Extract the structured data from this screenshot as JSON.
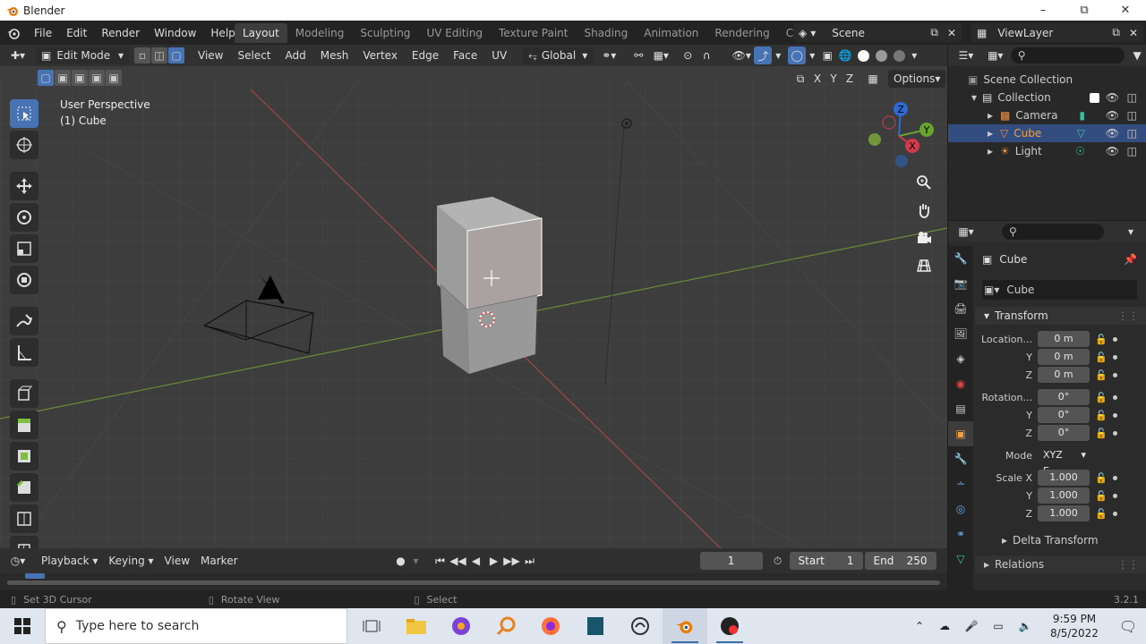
{
  "window": {
    "title": "Blender"
  },
  "menu": [
    "File",
    "Edit",
    "Render",
    "Window",
    "Help"
  ],
  "workspaces": [
    "Layout",
    "Modeling",
    "Sculpting",
    "UV Editing",
    "Texture Paint",
    "Shading",
    "Animation",
    "Rendering",
    "Compo"
  ],
  "active_workspace": "Layout",
  "scene": {
    "name": "Scene"
  },
  "view_layer": {
    "name": "ViewLayer"
  },
  "viewport_header": {
    "mode": "Edit Mode",
    "menus": [
      "View",
      "Select",
      "Add",
      "Mesh",
      "Vertex",
      "Edge",
      "Face",
      "UV"
    ],
    "orientation": "Global",
    "options_label": "Options",
    "axes": [
      "X",
      "Y",
      "Z"
    ]
  },
  "viewport": {
    "perspective_label": "User Perspective",
    "object_label": "(1) Cube"
  },
  "navigation_gizmo": {
    "axes": [
      "Z",
      "Y",
      "X"
    ]
  },
  "timeline": {
    "menus": [
      "Playback",
      "Keying",
      "View",
      "Marker"
    ],
    "current_frame": "1",
    "start_label": "Start",
    "start_value": "1",
    "end_label": "End",
    "end_value": "250"
  },
  "status_bar": {
    "items": [
      "Set 3D Cursor",
      "Rotate View",
      "Select"
    ],
    "version": "3.2.1"
  },
  "outliner": {
    "root": "Scene Collection",
    "collection": "Collection",
    "objects": [
      {
        "name": "Camera",
        "selected": false
      },
      {
        "name": "Cube",
        "selected": true
      },
      {
        "name": "Light",
        "selected": false
      }
    ]
  },
  "properties": {
    "object_name": "Cube",
    "data_name": "Cube",
    "panel": "Transform",
    "location": {
      "label": "Location...",
      "x": "0 m",
      "y": "0 m",
      "z": "0 m"
    },
    "rotation": {
      "label": "Rotation...",
      "x": "0°",
      "y": "0°",
      "z": "0°"
    },
    "mode": {
      "label": "Mode",
      "value": "XYZ E..."
    },
    "scale": {
      "label": "Scale X",
      "x": "1.000",
      "y": "1.000",
      "z": "1.000"
    },
    "axis_labels": {
      "y": "Y",
      "z": "Z"
    },
    "delta_transform": "Delta Transform",
    "relations": "Relations"
  },
  "taskbar": {
    "search_placeholder": "Type here to search",
    "time": "9:59 PM",
    "date": "8/5/2022"
  }
}
